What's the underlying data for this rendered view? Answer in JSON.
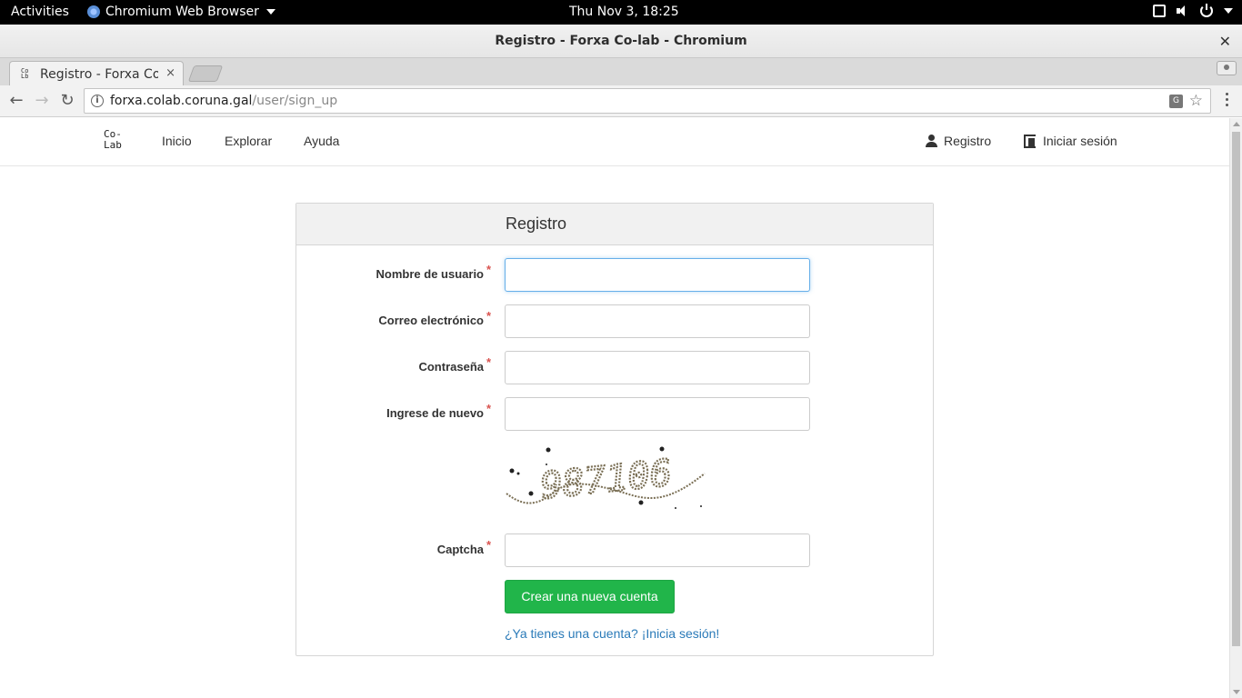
{
  "os_topbar": {
    "activities": "Activities",
    "app_name": "Chromium Web Browser",
    "clock": "Thu Nov  3, 18:25"
  },
  "window": {
    "title": "Registro - Forxa Co-lab - Chromium",
    "close_glyph": "✕"
  },
  "tabs": [
    {
      "label": "Registro - Forxa Co-lab",
      "close_glyph": "×"
    }
  ],
  "toolbar": {
    "back_glyph": "←",
    "forward_glyph": "→",
    "reload_glyph": "↻",
    "url_host": "forxa.colab.coruna.gal",
    "url_path": "/user/sign_up",
    "info_glyph": "i",
    "star_glyph": "☆"
  },
  "site_nav": {
    "logo_line1": "Co-",
    "logo_line2": "Lab",
    "links": [
      "Inicio",
      "Explorar",
      "Ayuda"
    ],
    "register": "Registro",
    "login": "Iniciar sesión"
  },
  "form": {
    "heading": "Registro",
    "required_mark": "*",
    "fields": [
      {
        "label": "Nombre de usuario",
        "value": "",
        "placeholder": ""
      },
      {
        "label": "Correo electrónico",
        "value": "",
        "placeholder": ""
      },
      {
        "label": "Contraseña",
        "value": "",
        "placeholder": ""
      },
      {
        "label": "Ingrese de nuevo",
        "value": "",
        "placeholder": ""
      }
    ],
    "captcha_label": "Captcha",
    "captcha_text": "987106",
    "submit": "Crear una nueva cuenta",
    "login_link": "¿Ya tienes una cuenta? ¡Inicia sesión!"
  },
  "colors": {
    "accent_green": "#21b54a",
    "link_blue": "#2a7ab8",
    "required_red": "#d9534f"
  }
}
